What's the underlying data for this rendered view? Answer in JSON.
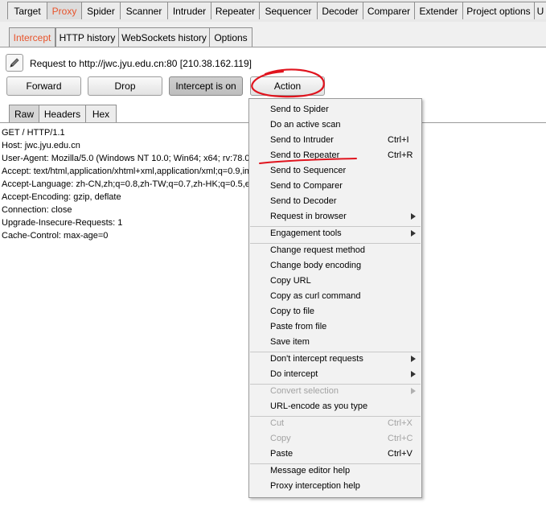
{
  "top_tabs": [
    {
      "label": "Target",
      "active": false
    },
    {
      "label": "Proxy",
      "active": true
    },
    {
      "label": "Spider",
      "active": false
    },
    {
      "label": "Scanner",
      "active": false
    },
    {
      "label": "Intruder",
      "active": false
    },
    {
      "label": "Repeater",
      "active": false
    },
    {
      "label": "Sequencer",
      "active": false
    },
    {
      "label": "Decoder",
      "active": false
    },
    {
      "label": "Comparer",
      "active": false
    },
    {
      "label": "Extender",
      "active": false
    },
    {
      "label": "Project options",
      "active": false
    },
    {
      "label": "U",
      "active": false
    }
  ],
  "sub_tabs": [
    {
      "label": "Intercept",
      "active": true
    },
    {
      "label": "HTTP history",
      "active": false
    },
    {
      "label": "WebSockets history",
      "active": false
    },
    {
      "label": "Options",
      "active": false
    }
  ],
  "request_info": "Request to http://jwc.jyu.edu.cn:80  [210.38.162.119]",
  "buttons": {
    "forward": "Forward",
    "drop": "Drop",
    "intercept": "Intercept is on",
    "action": "Action"
  },
  "view_tabs": [
    {
      "label": "Raw",
      "active": true
    },
    {
      "label": "Headers",
      "active": false
    },
    {
      "label": "Hex",
      "active": false
    }
  ],
  "request_lines": [
    "GET / HTTP/1.1",
    "Host: jwc.jyu.edu.cn",
    "User-Agent: Mozilla/5.0 (Windows NT 10.0; Win64; x64; rv:78.0",
    "Accept: text/html,application/xhtml+xml,application/xml;q=0.9,ima",
    "Accept-Language: zh-CN,zh;q=0.8,zh-TW;q=0.7,zh-HK;q=0.5,e",
    "Accept-Encoding: gzip, deflate",
    "Connection: close",
    "Upgrade-Insecure-Requests: 1",
    "Cache-Control: max-age=0"
  ],
  "menu": {
    "send_to_spider": "Send to Spider",
    "do_active_scan": "Do an active scan",
    "send_to_intruder": "Send to Intruder",
    "send_to_intruder_shortcut": "Ctrl+I",
    "send_to_repeater": "Send to Repeater",
    "send_to_repeater_shortcut": "Ctrl+R",
    "send_to_sequencer": "Send to Sequencer",
    "send_to_comparer": "Send to Comparer",
    "send_to_decoder": "Send to Decoder",
    "request_in_browser": "Request in browser",
    "engagement_tools": "Engagement tools",
    "change_request_method": "Change request method",
    "change_body_encoding": "Change body encoding",
    "copy_url": "Copy URL",
    "copy_as_curl": "Copy as curl command",
    "copy_to_file": "Copy to file",
    "paste_from_file": "Paste from file",
    "save_item": "Save item",
    "dont_intercept": "Don't intercept requests",
    "do_intercept": "Do intercept",
    "convert_selection": "Convert selection",
    "url_encode_as_you_type": "URL-encode as you type",
    "cut": "Cut",
    "cut_shortcut": "Ctrl+X",
    "copy": "Copy",
    "copy_shortcut": "Ctrl+C",
    "paste": "Paste",
    "paste_shortcut": "Ctrl+V",
    "message_editor_help": "Message editor help",
    "proxy_interception_help": "Proxy interception help"
  },
  "colors": {
    "active_tab_text": "#e8542c",
    "annotation_red": "#e0141e"
  },
  "icons": {
    "edit": "pencil-icon",
    "submenu": "submenu-arrow-icon"
  }
}
